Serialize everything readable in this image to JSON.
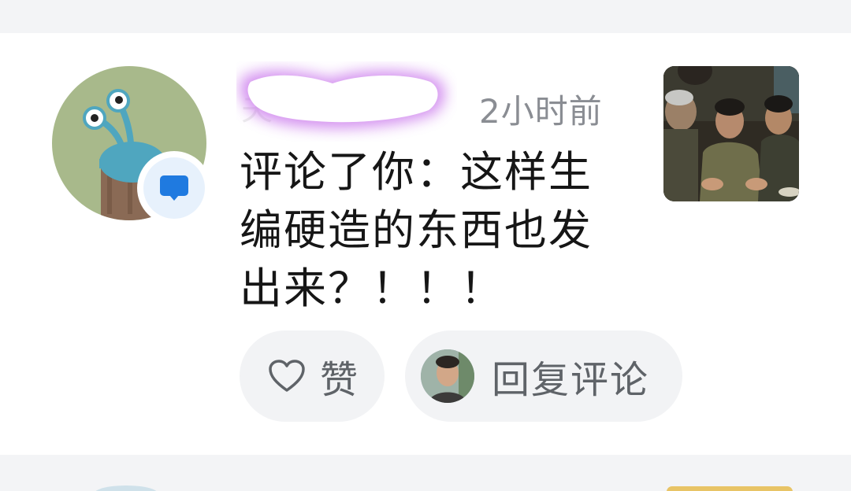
{
  "notification": {
    "username": "夫",
    "timestamp": "2小时前",
    "comment_text": "评论了你：这样生编硬造的东西也发出来？！！！",
    "actions": {
      "like_label": "赞",
      "reply_label": "回复评论"
    }
  },
  "icons": {
    "badge": "comment-bubble-icon",
    "like": "heart-outline-icon"
  },
  "colors": {
    "accent_blue": "#1f7ae0",
    "redaction": "#c56bea",
    "timestamp_gray": "#8a8d93",
    "pill_bg": "#f2f3f5"
  }
}
